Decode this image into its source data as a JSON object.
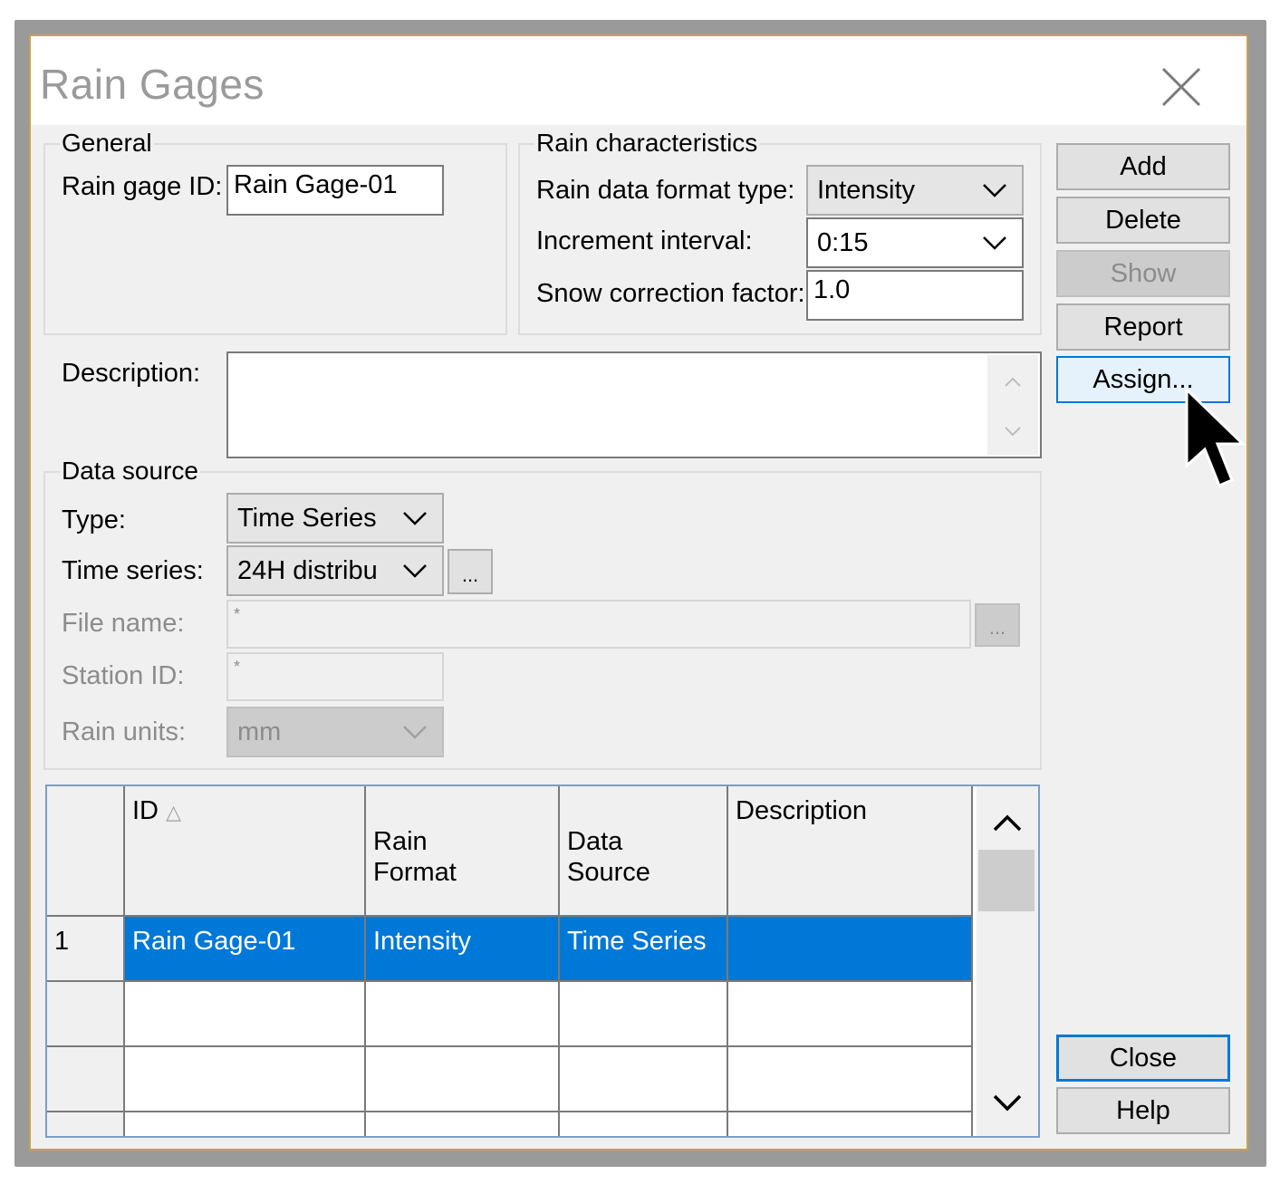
{
  "dialog": {
    "title": "Rain Gages",
    "close_icon": "close-icon"
  },
  "general": {
    "legend": "General",
    "gage_id_label": "Rain gage ID:",
    "gage_id_value": "Rain Gage-01"
  },
  "rain_characteristics": {
    "legend": "Rain characteristics",
    "format_label": "Rain data format type:",
    "format_value": "Intensity",
    "interval_label": "Increment interval:",
    "interval_value": "0:15",
    "snow_label": "Snow correction factor:",
    "snow_value": "1.0"
  },
  "description": {
    "label": "Description:",
    "value": ""
  },
  "data_source": {
    "legend": "Data source",
    "type_label": "Type:",
    "type_value": "Time Series",
    "series_label": "Time series:",
    "series_value": "24H distribu",
    "browse_label": "...",
    "file_label": "File name:",
    "file_value": "*",
    "file_browse_label": "...",
    "station_label": "Station ID:",
    "station_value": "*",
    "units_label": "Rain units:",
    "units_value": "mm"
  },
  "buttons": {
    "add": "Add",
    "delete": "Delete",
    "show": "Show",
    "report": "Report",
    "assign": "Assign...",
    "close": "Close",
    "help": "Help"
  },
  "table": {
    "columns": [
      "ID",
      "Rain\nFormat",
      "Data\nSource",
      "Description"
    ],
    "sort_indicator": "△",
    "rows": [
      {
        "num": "1",
        "id": "Rain Gage-01",
        "format": "Intensity",
        "source": "Time Series",
        "description": ""
      }
    ]
  },
  "colors": {
    "selection": "#0078d7",
    "focus_border": "#0078d7",
    "dialog_bg": "#f0f0f0"
  }
}
